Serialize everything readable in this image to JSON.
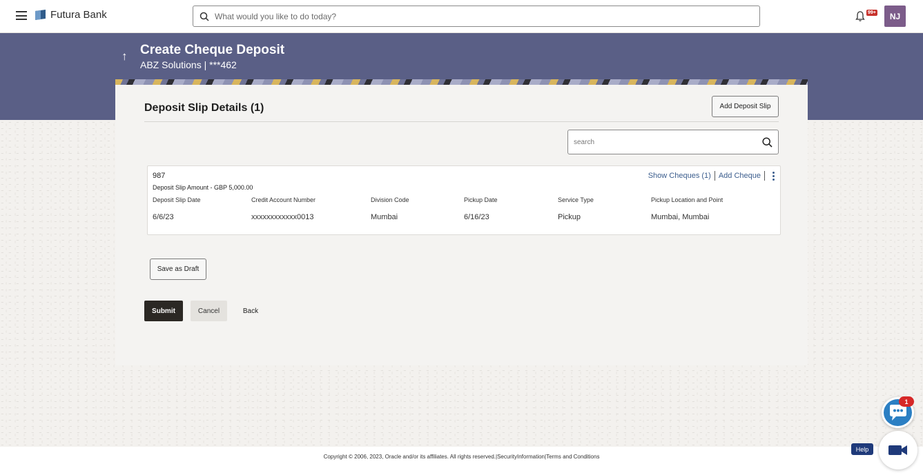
{
  "header": {
    "brand": "Futura Bank",
    "search_placeholder": "What would you like to do today?",
    "notification_badge": "99+",
    "avatar_initials": "NJ"
  },
  "page": {
    "title": "Create Cheque Deposit",
    "subtitle": "ABZ Solutions | ***462"
  },
  "section": {
    "title": "Deposit Slip Details (1)",
    "add_slip_label": "Add Deposit Slip",
    "search_placeholder": "search"
  },
  "slip": {
    "id": "987",
    "amount": "Deposit Slip Amount - GBP 5,000.00",
    "show_cheques": "Show Cheques (1)",
    "add_cheque": "Add Cheque",
    "columns": [
      {
        "header": "Deposit Slip Date",
        "value": "6/6/23"
      },
      {
        "header": "Credit Account Number",
        "value": "xxxxxxxxxxxx0013"
      },
      {
        "header": "Division Code",
        "value": "Mumbai"
      },
      {
        "header": "Pickup Date",
        "value": "6/16/23"
      },
      {
        "header": "Service Type",
        "value": "Pickup"
      },
      {
        "header": "Pickup Location and Point",
        "value": "Mumbai, Mumbai"
      }
    ]
  },
  "actions": {
    "save_draft": "Save as Draft",
    "submit": "Submit",
    "cancel": "Cancel",
    "back": "Back"
  },
  "footer": {
    "copyright": "Copyright © 2006, 2023, Oracle and/or its affiliates. All rights reserved.|SecurityInformation|Terms and Conditions"
  },
  "widgets": {
    "chat_badge": "1",
    "help_label": "Help"
  },
  "colors": {
    "banner": "#5a5f86",
    "primary_button": "#2b2824",
    "link": "#3b5d8d",
    "chat": "#2b7fc3",
    "badge": "#d62828"
  }
}
